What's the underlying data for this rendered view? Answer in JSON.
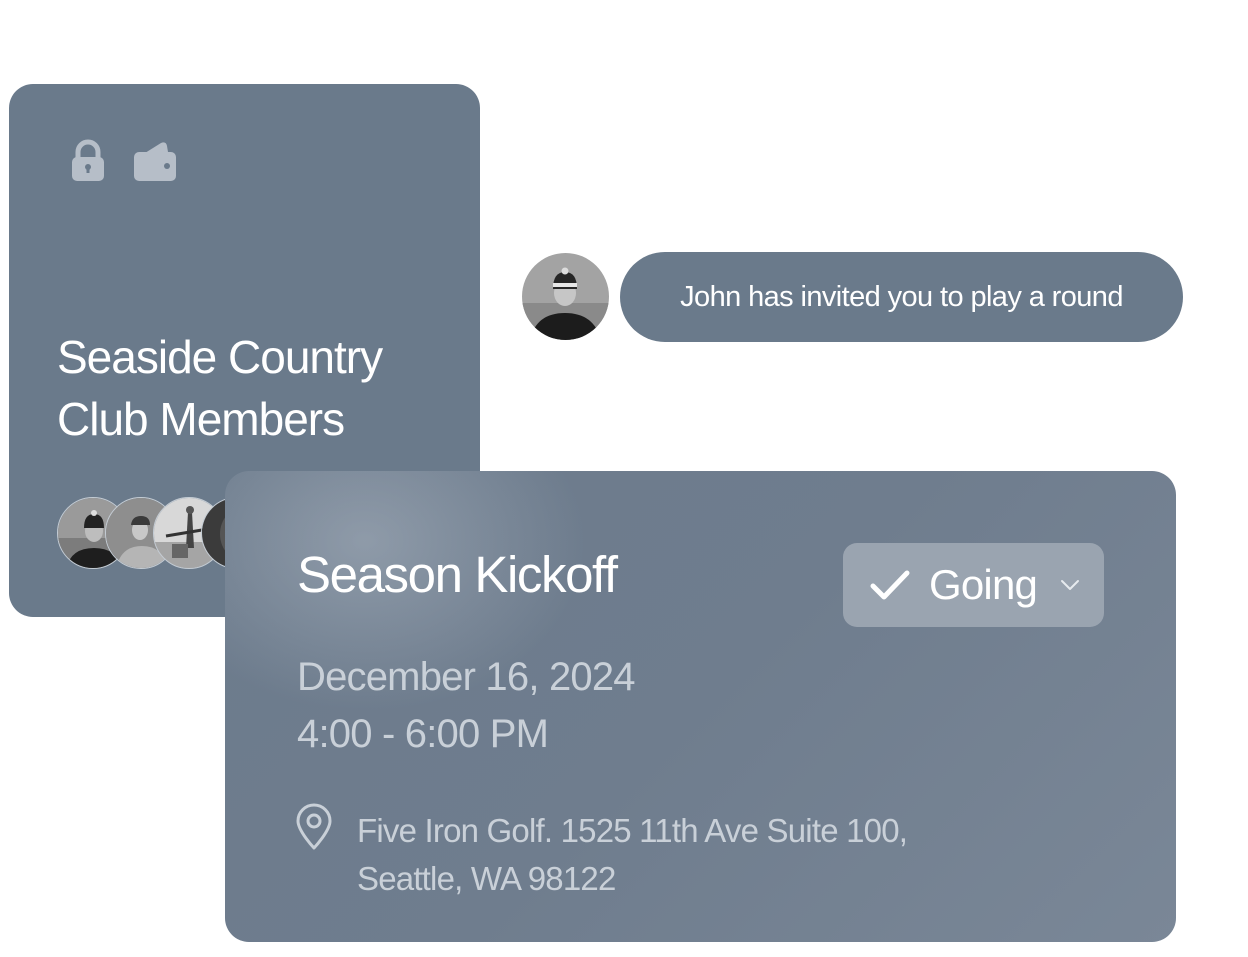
{
  "club_card": {
    "title_line1": "Seaside Country",
    "title_line2": "Club Members",
    "icons": [
      "lock-icon",
      "wallet-icon"
    ],
    "members_count_visible": 4
  },
  "invite": {
    "message": "John has invited you to play a round"
  },
  "event": {
    "title": "Season Kickoff",
    "rsvp_status": "Going",
    "date": "December 16, 2024",
    "time": "4:00 - 6:00 PM",
    "location_line1": "Five Iron Golf. 1525 11th Ave Suite 100,",
    "location_line2": "Seattle, WA 98122"
  },
  "colors": {
    "card_bg": "#6a7a8b",
    "button_bg": "#9aa4b0",
    "muted_text": "#c9d0d8",
    "icon_fill": "#b6bec8"
  }
}
